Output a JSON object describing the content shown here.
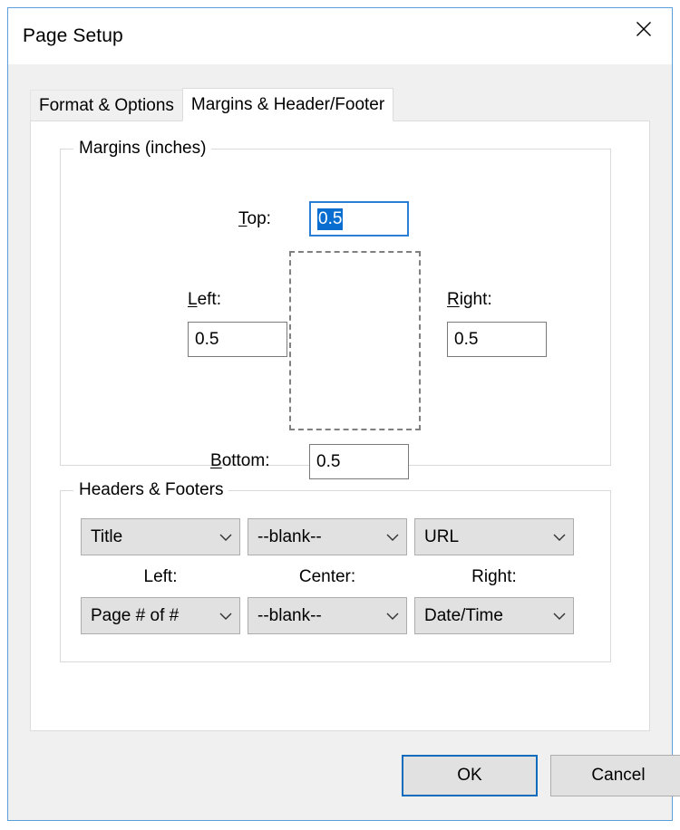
{
  "window": {
    "title": "Page Setup",
    "close_icon": "close-icon",
    "border_color": "#5ba0dd"
  },
  "tabs": [
    {
      "label": "Format & Options",
      "active": false
    },
    {
      "label": "Margins & Header/Footer",
      "active": true
    }
  ],
  "margins": {
    "legend": "Margins (inches)",
    "unit": "inches",
    "top": {
      "label_prefix": "T",
      "label_rest": "op:",
      "label": "Top:",
      "value": "0.5",
      "focused": true,
      "selected": true
    },
    "left": {
      "label_prefix": "L",
      "label_rest": "eft:",
      "label": "Left:",
      "value": "0.5",
      "focused": false,
      "selected": false
    },
    "right": {
      "label_prefix": "R",
      "label_rest": "ight:",
      "label": "Right:",
      "value": "0.5",
      "focused": false,
      "selected": false
    },
    "bottom": {
      "label_prefix": "B",
      "label_rest": "ottom:",
      "label": "Bottom:",
      "value": "0.5",
      "focused": false,
      "selected": false
    },
    "preview_icon": "page-preview-dashed-rect"
  },
  "headers_footers": {
    "legend": "Headers & Footers",
    "column_labels": {
      "left": "Left:",
      "center": "Center:",
      "right": "Right:"
    },
    "header_row": [
      {
        "position": "left",
        "value": "Title"
      },
      {
        "position": "center",
        "value": "--blank--"
      },
      {
        "position": "right",
        "value": "URL"
      }
    ],
    "footer_row": [
      {
        "position": "left",
        "value": "Page # of #"
      },
      {
        "position": "center",
        "value": "--blank--"
      },
      {
        "position": "right",
        "value": "Date/Time"
      }
    ],
    "dropdown_arrow_icon": "chevron-down-icon"
  },
  "footer": {
    "ok_label": "OK",
    "cancel_label": "Cancel",
    "default_button": "OK",
    "accent_color": "#0f6cbd"
  }
}
